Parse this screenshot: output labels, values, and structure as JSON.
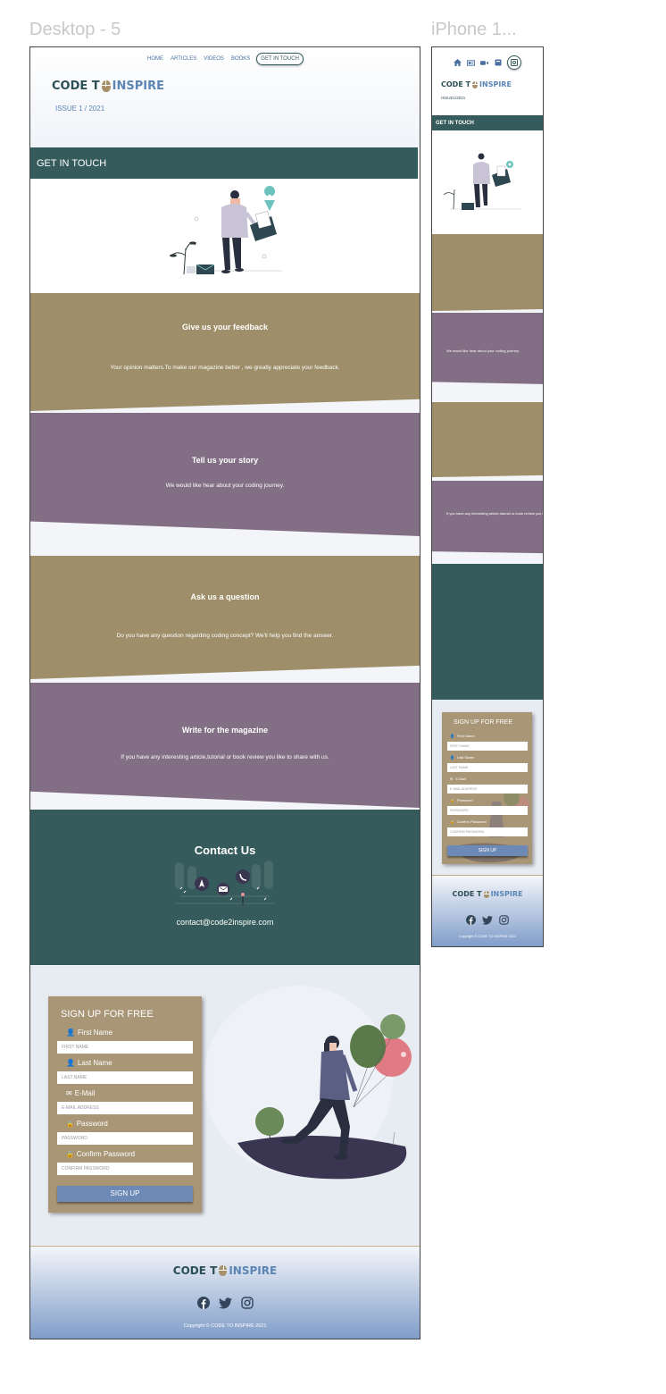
{
  "frames": {
    "desktop_label": "Desktop - 5",
    "phone_label": "iPhone 1..."
  },
  "brand": {
    "word1": "CODE T",
    "word2": "INSPIRE",
    "issue": "ISSUE 1 / 2021",
    "issue_mobile": "ISSUE1/2021"
  },
  "nav": {
    "items": [
      "HOME",
      "ARTICLES",
      "VIDEOS",
      "BOOKS"
    ],
    "active": "GET IN TOUCH"
  },
  "page_title": "GET IN TOUCH",
  "sections": [
    {
      "title": "Give us your feedback",
      "text": "Your opinion matters.To make our magazine better , we greatly appreciate your feedback.",
      "color": "#9e8e69"
    },
    {
      "title": "Tell us your story",
      "text": "We would like hear about your coding journey.",
      "color": "#836f85"
    },
    {
      "title": "Ask us a question",
      "text": "Do you have any question regarding coding concept? We'll help you find the answer.",
      "color": "#9e8e69"
    },
    {
      "title": "Write for the magazine",
      "text": "If you have any interesting article,tutorial or book review you like to share with us.",
      "color": "#836f85"
    }
  ],
  "contact": {
    "title": "Contact Us",
    "email": "contact@code2inspire.com"
  },
  "signup": {
    "title": "SIGN UP FOR FREE",
    "fields": [
      {
        "label": "First Name",
        "placeholder": "FIRST NAME",
        "icon": "user-icon"
      },
      {
        "label": "Last Name",
        "placeholder": "LAST NAME",
        "icon": "user-icon"
      },
      {
        "label": "E-Mail",
        "placeholder": "E-MAIL ADDRESS",
        "icon": "mail-icon"
      },
      {
        "label": "Password",
        "placeholder": "PASSWORD",
        "icon": "lock-icon"
      },
      {
        "label": "Confirm Password",
        "placeholder": "CONFIRM PASSWORD",
        "icon": "lock-icon"
      }
    ],
    "button": "SIGN UP"
  },
  "footer": {
    "copyright": "Copyright © CODE TO INSPIRE 2021",
    "social": [
      "facebook-icon",
      "twitter-icon",
      "instagram-icon"
    ]
  },
  "colors": {
    "teal": "#365b5c",
    "tan": "#9e8e69",
    "purple": "#836f85",
    "blue": "#5c85b6",
    "form": "#a89677",
    "button": "#6c8ab5"
  }
}
